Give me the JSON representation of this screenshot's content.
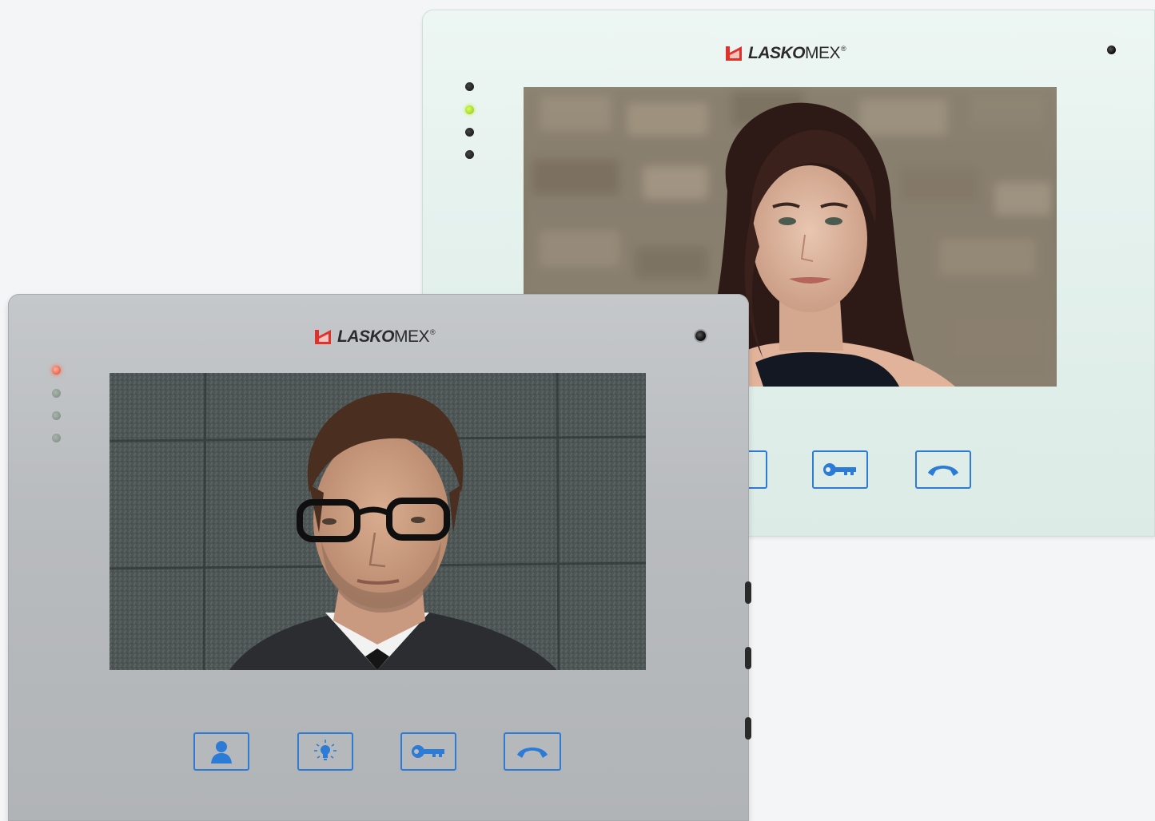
{
  "brand": {
    "name_bold": "LASKO",
    "name_light": "MEX",
    "registered": "®",
    "mark_color": "#e0312b"
  },
  "colors": {
    "button_outline": "#2c7bd6",
    "white_frame": "#e3f0ec",
    "silver_frame": "#b9bcbf"
  },
  "monitors": [
    {
      "variant": "white",
      "leds": [
        "off",
        "green-on",
        "off",
        "off"
      ],
      "screen": "video-feed-woman-portrait",
      "buttons": [
        "key-icon",
        "hang-up-icon"
      ]
    },
    {
      "variant": "silver",
      "leds": [
        "red-on",
        "off",
        "off",
        "off"
      ],
      "screen": "video-feed-man-portrait",
      "buttons": [
        "person-icon",
        "light-bulb-icon",
        "key-icon",
        "hang-up-icon"
      ]
    }
  ]
}
